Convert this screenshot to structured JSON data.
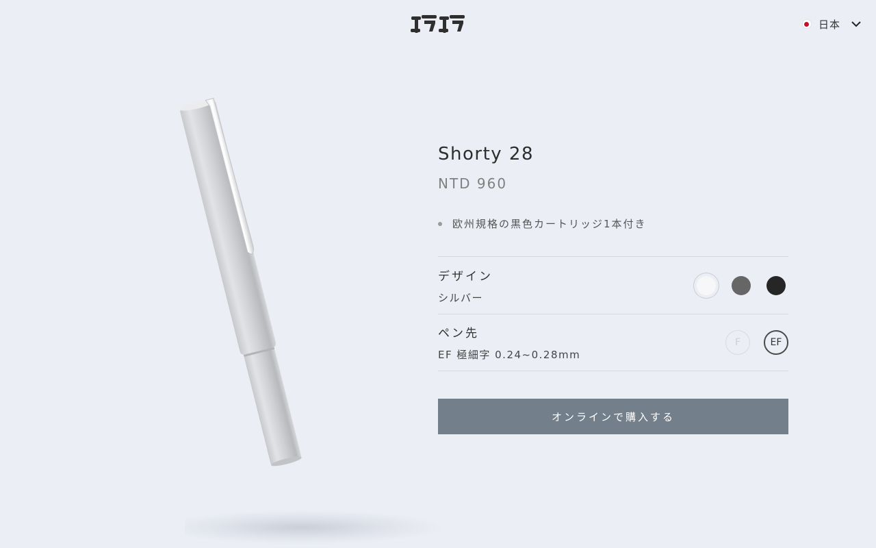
{
  "brand": {
    "logo_text": "巧巧"
  },
  "header": {
    "language": {
      "label": "日本",
      "flag": "japan-flag-icon"
    }
  },
  "product": {
    "name": "Shorty 28",
    "price": "NTD 960",
    "features": [
      "欧州規格の黒色カートリッジ1本付き"
    ],
    "design": {
      "label": "デザイン",
      "selected": "シルバー",
      "swatches": [
        {
          "color": "#f7f7f9",
          "selected": true
        },
        {
          "color": "#666666",
          "selected": false
        },
        {
          "color": "#262626",
          "selected": false
        }
      ]
    },
    "nib": {
      "label": "ペン先",
      "selected": "EF 極細字 0.24~0.28mm",
      "options": [
        {
          "label": "F",
          "state": "disabled"
        },
        {
          "label": "EF",
          "state": "active"
        }
      ]
    },
    "buy_label": "オンラインで購入する"
  },
  "colors": {
    "background": "#ebeef5",
    "button": "#737f8b",
    "flag_red": "#c8102e"
  }
}
